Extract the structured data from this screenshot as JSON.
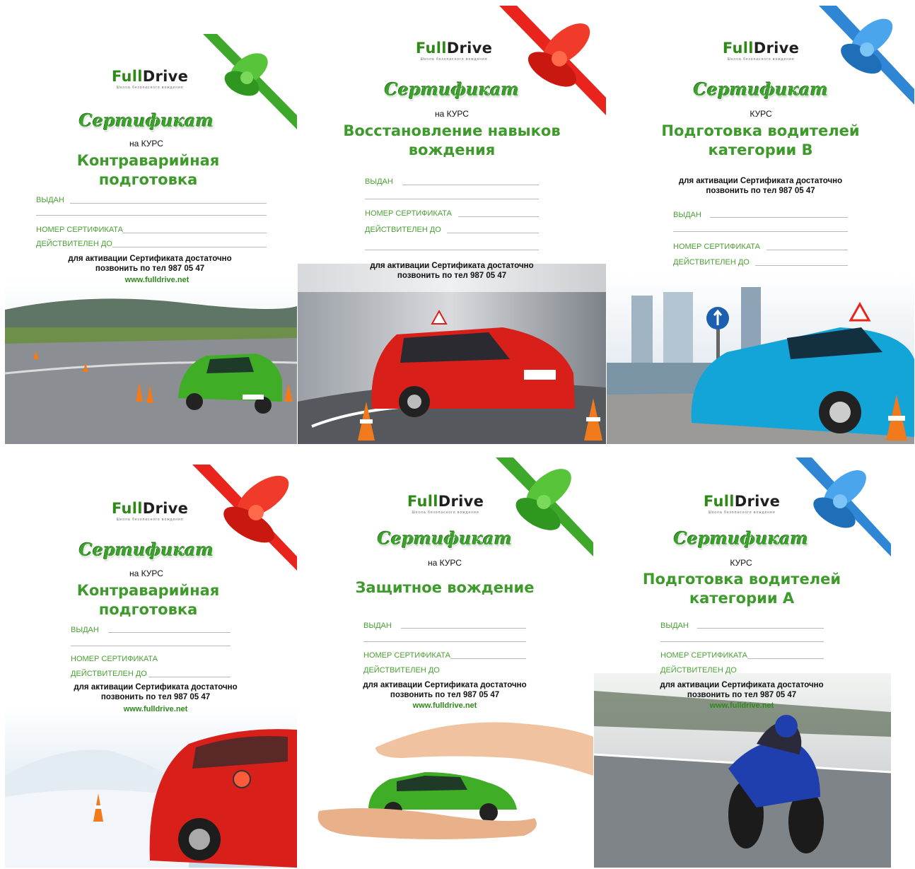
{
  "brand": {
    "part1": "Full",
    "part2": "Drive",
    "tagline": "Школа безопасного вождения"
  },
  "certificate_word": "Сертификат",
  "activation_line1": "для активации Сертификата достаточно",
  "activation_line2": "позвонить по тел 987 05 47",
  "website": "www.fulldrive.net",
  "fields": {
    "issued": "ВЫДАН",
    "number": "НОМЕР СЕРТИФИКАТА",
    "valid": "ДЕЙСТВИТЕЛЕН ДО"
  },
  "cards": [
    {
      "ribbon_color": "#3ea82a",
      "course_label": "на КУРС",
      "title_line1": "Контраварийная",
      "title_line2": "подготовка",
      "photo": "green-hatchback-on-training-track-with-cones"
    },
    {
      "ribbon_color": "#e8241c",
      "course_label": "на КУРС",
      "title_line1": "Восстановление навыков",
      "title_line2": "вождения",
      "photo": "red-hatchback-with-learner-sign-and-cones"
    },
    {
      "ribbon_color": "#2f86d4",
      "course_label": "КУРС",
      "title_line1": "Подготовка водителей",
      "title_line2": "категории В",
      "photo": "blue-car-city-skyline-road-sign"
    },
    {
      "ribbon_color": "#e8241c",
      "course_label": "на КУРС",
      "title_line1": "Контраварийная",
      "title_line2": "подготовка",
      "photo": "red-car-on-snow-with-cone"
    },
    {
      "ribbon_color": "#3ea82a",
      "course_label": "на КУРС",
      "title_line1": "Защитное вождение",
      "title_line2": "",
      "photo": "green-car-held-by-hands"
    },
    {
      "ribbon_color": "#2f86d4",
      "course_label": "КУРС",
      "title_line1": "Подготовка водителей",
      "title_line2": "категории А",
      "photo": "blue-motorcycle-on-track"
    }
  ]
}
